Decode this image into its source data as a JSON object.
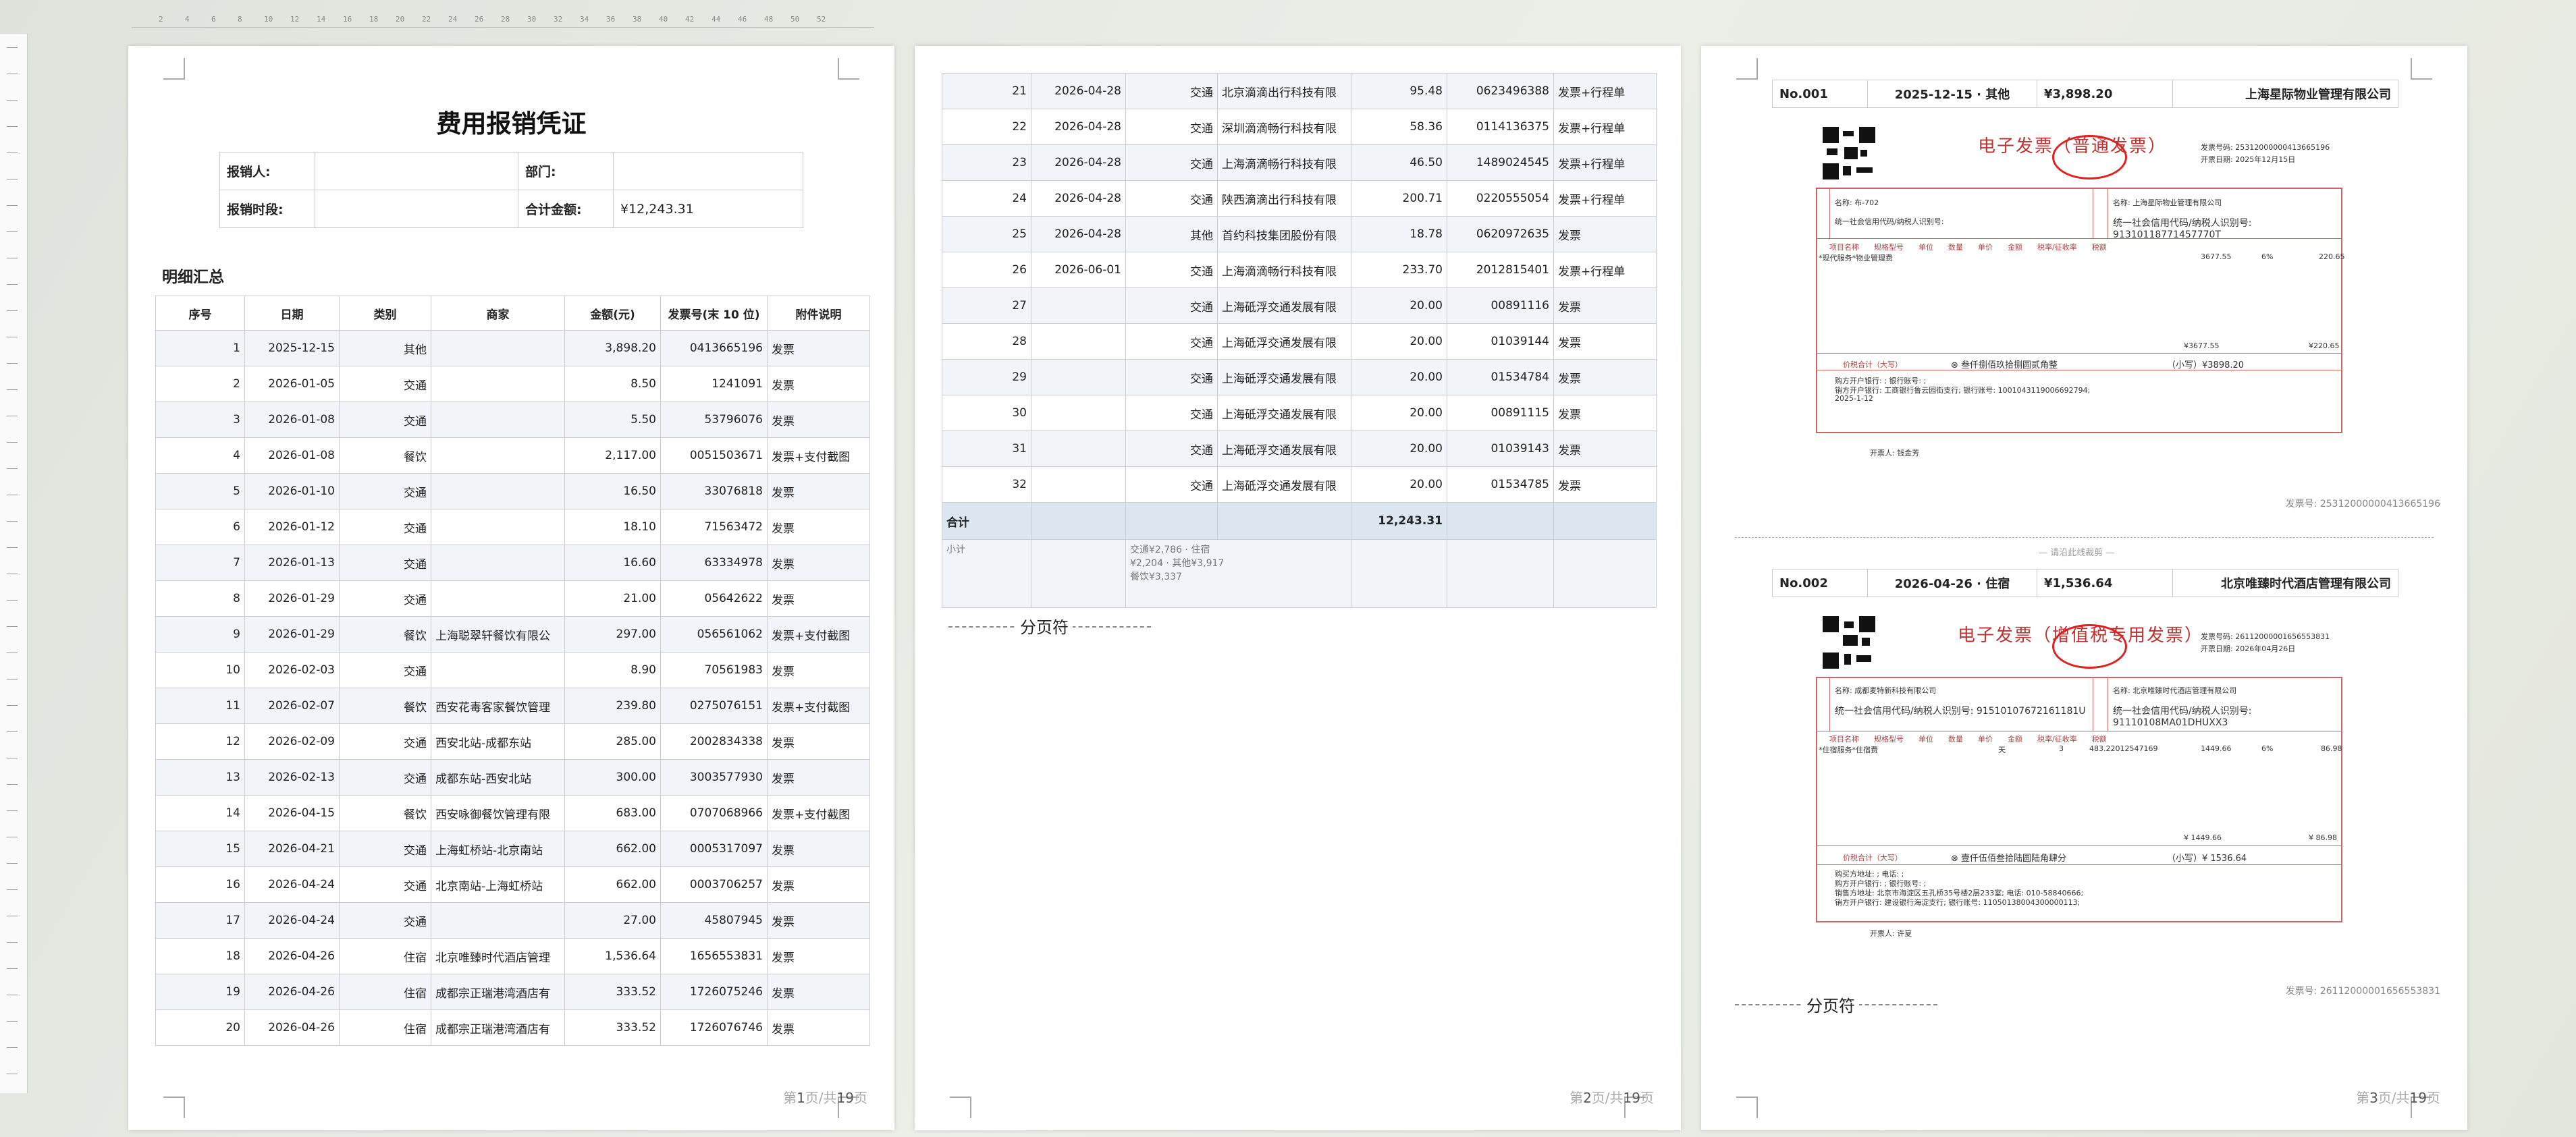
{
  "ruler_ticks": [
    "2",
    "4",
    "6",
    "8",
    "10",
    "12",
    "14",
    "16",
    "18",
    "20",
    "22",
    "24",
    "26",
    "28",
    "30",
    "32",
    "34",
    "36",
    "38",
    "40",
    "42",
    "44",
    "46",
    "48",
    "50",
    "52"
  ],
  "page1": {
    "title": "费用报销凭证",
    "info": {
      "reporter_label": "报销人:",
      "reporter_value": "",
      "dept_label": "部门:",
      "dept_value": "",
      "period_label": "报销时段:",
      "period_value": "",
      "total_label": "合计金额:",
      "total_value": "¥12,243.31"
    },
    "section_title": "明细汇总",
    "columns": [
      "序号",
      "日期",
      "类别",
      "商家",
      "金额(元)",
      "发票号(末 10 位)",
      "附件说明"
    ],
    "rows": [
      [
        "1",
        "2025-12-15",
        "其他",
        "",
        "3,898.20",
        "0413665196",
        "发票"
      ],
      [
        "2",
        "2026-01-05",
        "交通",
        "",
        "8.50",
        "1241091",
        "发票"
      ],
      [
        "3",
        "2026-01-08",
        "交通",
        "",
        "5.50",
        "53796076",
        "发票"
      ],
      [
        "4",
        "2026-01-08",
        "餐饮",
        "",
        "2,117.00",
        "0051503671",
        "发票+支付截图"
      ],
      [
        "5",
        "2026-01-10",
        "交通",
        "",
        "16.50",
        "33076818",
        "发票"
      ],
      [
        "6",
        "2026-01-12",
        "交通",
        "",
        "18.10",
        "71563472",
        "发票"
      ],
      [
        "7",
        "2026-01-13",
        "交通",
        "",
        "16.60",
        "63334978",
        "发票"
      ],
      [
        "8",
        "2026-01-29",
        "交通",
        "",
        "21.00",
        "05642622",
        "发票"
      ],
      [
        "9",
        "2026-01-29",
        "餐饮",
        "上海聪翠轩餐饮有限公",
        "297.00",
        "056561062",
        "发票+支付截图"
      ],
      [
        "10",
        "2026-02-03",
        "交通",
        "",
        "8.90",
        "70561983",
        "发票"
      ],
      [
        "11",
        "2026-02-07",
        "餐饮",
        "西安花毒客家餐饮管理",
        "239.80",
        "0275076151",
        "发票+支付截图"
      ],
      [
        "12",
        "2026-02-09",
        "交通",
        "西安北站-成都东站",
        "285.00",
        "2002834338",
        "发票"
      ],
      [
        "13",
        "2026-02-13",
        "交通",
        "成都东站-西安北站",
        "300.00",
        "3003577930",
        "发票"
      ],
      [
        "14",
        "2026-04-15",
        "餐饮",
        "西安咏御餐饮管理有限",
        "683.00",
        "0707068966",
        "发票+支付截图"
      ],
      [
        "15",
        "2026-04-21",
        "交通",
        "上海虹桥站-北京南站",
        "662.00",
        "0005317097",
        "发票"
      ],
      [
        "16",
        "2026-04-24",
        "交通",
        "北京南站-上海虹桥站",
        "662.00",
        "0003706257",
        "发票"
      ],
      [
        "17",
        "2026-04-24",
        "交通",
        "",
        "27.00",
        "45807945",
        "发票"
      ],
      [
        "18",
        "2026-04-26",
        "住宿",
        "北京唯臻时代酒店管理",
        "1,536.64",
        "1656553831",
        "发票"
      ],
      [
        "19",
        "2026-04-26",
        "住宿",
        "成都宗正瑞港湾酒店有",
        "333.52",
        "1726075246",
        "发票"
      ],
      [
        "20",
        "2026-04-26",
        "住宿",
        "成都宗正瑞港湾酒店有",
        "333.52",
        "1726076746",
        "发票"
      ]
    ],
    "page_label_pre": "第",
    "page_cur": "1",
    "page_label_mid": "页/共",
    "page_total": "19",
    "page_label_post": "页"
  },
  "page2": {
    "rows": [
      [
        "21",
        "2026-04-28",
        "交通",
        "北京滴滴出行科技有限",
        "95.48",
        "0623496388",
        "发票+行程单"
      ],
      [
        "22",
        "2026-04-28",
        "交通",
        "深圳滴滴畅行科技有限",
        "58.36",
        "0114136375",
        "发票+行程单"
      ],
      [
        "23",
        "2026-04-28",
        "交通",
        "上海滴滴畅行科技有限",
        "46.50",
        "1489024545",
        "发票+行程单"
      ],
      [
        "24",
        "2026-04-28",
        "交通",
        "陕西滴滴出行科技有限",
        "200.71",
        "0220555054",
        "发票+行程单"
      ],
      [
        "25",
        "2026-04-28",
        "其他",
        "首约科技集团股份有限",
        "18.78",
        "0620972635",
        "发票"
      ],
      [
        "26",
        "2026-06-01",
        "交通",
        "上海滴滴畅行科技有限",
        "233.70",
        "2012815401",
        "发票+行程单"
      ],
      [
        "27",
        "",
        "交通",
        "上海砥浮交通发展有限",
        "20.00",
        "00891116",
        "发票"
      ],
      [
        "28",
        "",
        "交通",
        "上海砥浮交通发展有限",
        "20.00",
        "01039144",
        "发票"
      ],
      [
        "29",
        "",
        "交通",
        "上海砥浮交通发展有限",
        "20.00",
        "01534784",
        "发票"
      ],
      [
        "30",
        "",
        "交通",
        "上海砥浮交通发展有限",
        "20.00",
        "00891115",
        "发票"
      ],
      [
        "31",
        "",
        "交通",
        "上海砥浮交通发展有限",
        "20.00",
        "01039143",
        "发票"
      ],
      [
        "32",
        "",
        "交通",
        "上海砥浮交通发展有限",
        "20.00",
        "01534785",
        "发票"
      ]
    ],
    "sum_label": "合计",
    "sum_value": "12,243.31",
    "subtotal_label": "小计",
    "subtotal_line1": "交通¥2,786 · 住宿",
    "subtotal_line2": "¥2,204 · 其他¥3,917",
    "subtotal_line3": "餐饮¥3,337",
    "page_break": "分页符",
    "page_cur": "2",
    "page_total": "19"
  },
  "page3": {
    "inv1_head": {
      "no": "No.001",
      "meta": "2025-12-15 · 其他",
      "amount": "¥3,898.20",
      "vendor": "上海星际物业管理有限公司"
    },
    "inv1": {
      "title": "电子发票（普通发票）",
      "inv_no_label": "发票号码: 25312000000413665196",
      "date_label": "开票日期: 2025年12月15日",
      "buyer_name": "名称: 布-702",
      "seller_name": "名称: 上海星际物业管理有限公司",
      "seller_tax": "统一社会信用代码/纳税人识别号: 91310118771457770T",
      "item": "*现代服务*物业管理费",
      "amt1": "3677.55",
      "rate": "6%",
      "tax1": "220.65",
      "total_amt": "¥3677.55",
      "total_tax": "¥220.65",
      "big_label": "价税合计（大写）",
      "big_value": "叁仟捌佰玖拾捌圆贰角整",
      "small_value": "（小写）¥3898.20",
      "remark": "购方开户银行: ;    银行账号: ;",
      "remark2": "销方开户银行: 工商银行鲁云园街支行;    银行账号: 1001043119006692794;",
      "remark3": "2025-1-12",
      "issuer": "开票人: 钱金芳",
      "footer_no": "发票号: 25312000000413665196"
    },
    "cut_label": "— 请沿此线裁剪 —",
    "inv2_head": {
      "no": "No.002",
      "meta": "2026-04-26 · 住宿",
      "amount": "¥1,536.64",
      "vendor": "北京唯臻时代酒店管理有限公司"
    },
    "inv2": {
      "title": "电子发票（增值税专用发票）",
      "inv_no_label": "发票号码: 26112000001656553831",
      "date_label": "开票日期: 2026年04月26日",
      "buyer_name": "名称: 成都麦特新科技有限公司",
      "buyer_tax": "统一社会信用代码/纳税人识别号: 91510107672161181U",
      "seller_name": "名称: 北京唯臻时代酒店管理有限公司",
      "seller_tax": "统一社会信用代码/纳税人识别号: 91110108MA01DHUXX3",
      "item": "*住宿服务*住宿费",
      "unit": "天",
      "qty": "3",
      "price": "483.22012547169",
      "amt1": "1449.66",
      "rate": "6%",
      "tax1": "86.98",
      "total_amt": "¥ 1449.66",
      "total_tax": "¥ 86.98",
      "big_label": "价税合计（大写）",
      "big_value": "壹仟伍佰叁拾陆圆陆角肆分",
      "small_value": "（小写）¥ 1536.64",
      "remark": "购买方地址: ;    电话: ;",
      "remark2": "购方开户银行: ;    银行账号: ;",
      "remark3": "销售方地址: 北京市海淀区五孔桥35号楼2层233室;    电话: 010-58840666;",
      "remark4": "销方开户银行: 建设银行海淀支行;    银行账号: 11050138004300000113;",
      "issuer": "开票人: 许夏",
      "footer_no": "发票号: 26112000001656553831"
    },
    "page_break": "分页符",
    "page_cur": "3",
    "page_total": "19"
  }
}
